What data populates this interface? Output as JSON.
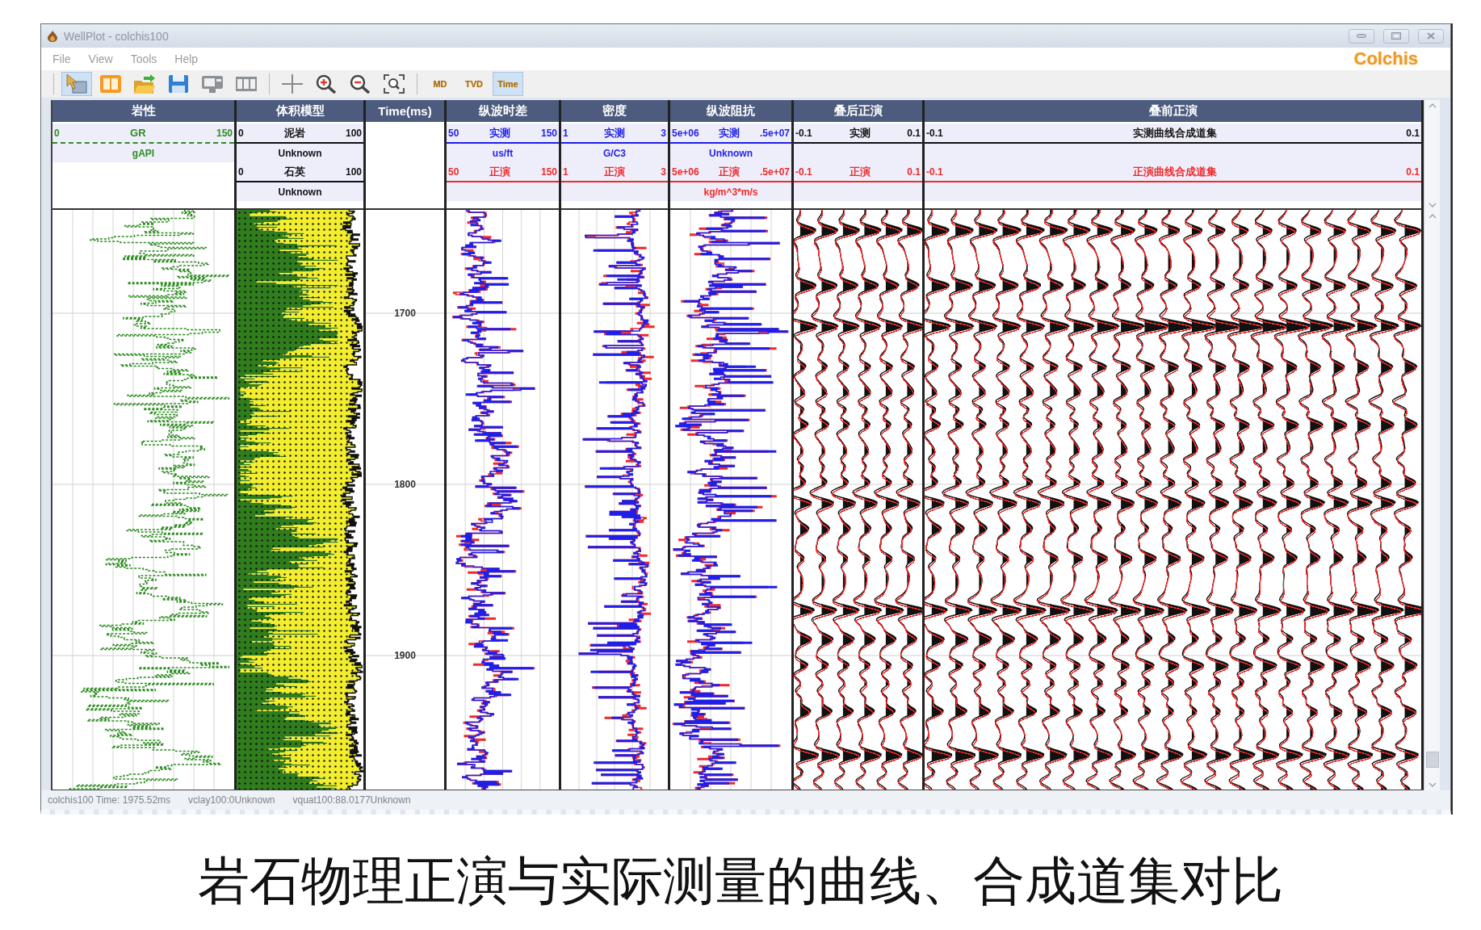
{
  "window": {
    "title": "WellPlot - colchis100",
    "logo": "Colchis"
  },
  "menu": [
    "File",
    "View",
    "Tools",
    "Help"
  ],
  "toolbar": {
    "tools": [
      {
        "selected": true
      },
      {
        "selected": false
      },
      {
        "selected": false
      },
      {
        "selected": false
      },
      {
        "selected": false
      },
      {
        "selected": false
      },
      {
        "selected": false
      },
      {
        "selected": false
      },
      {
        "selected": false
      },
      {
        "selected": false
      }
    ],
    "modes": [
      {
        "label": "MD",
        "selected": false
      },
      {
        "label": "TVD",
        "selected": false
      },
      {
        "label": "Time",
        "selected": true
      }
    ]
  },
  "tracks": [
    {
      "kind": "log",
      "title": "岩性",
      "curves": [
        {
          "min": "0",
          "name": "GR",
          "max": "150",
          "unit": "gAPI",
          "color": "#2e8b22",
          "dashed": true
        }
      ]
    },
    {
      "kind": "fill",
      "title": "体积模型",
      "curves": [
        {
          "min": "0",
          "name": "泥岩",
          "max": "100",
          "unit": "Unknown",
          "color": "#2f7d1c",
          "dashed": false
        },
        {
          "min": "0",
          "name": "石英",
          "max": "100",
          "unit": "Unknown",
          "color": "#f2ee2e",
          "dashed": false
        }
      ]
    },
    {
      "kind": "depth",
      "title": "Time(ms)",
      "ticks": [
        "1700",
        "1800",
        "1900"
      ]
    },
    {
      "kind": "log",
      "title": "纵波时差",
      "curves": [
        {
          "min": "50",
          "name": "实测",
          "max": "150",
          "unit": "us/ft",
          "color": "#1f1fe8",
          "dashed": false
        },
        {
          "min": "50",
          "name": "正演",
          "max": "150",
          "color": "#ee2a2a",
          "dashed": false
        }
      ]
    },
    {
      "kind": "log",
      "title": "密度",
      "curves": [
        {
          "min": "1",
          "name": "实测",
          "max": "3",
          "unit": "G/C3",
          "color": "#1f1fe8",
          "dashed": false
        },
        {
          "min": "1",
          "name": "正演",
          "max": "3",
          "color": "#ee2a2a",
          "dashed": false
        }
      ]
    },
    {
      "kind": "log",
      "title": "纵波阻抗",
      "curves": [
        {
          "min": "5e+06",
          "name": "实测",
          "max": ".5e+07",
          "unit": "Unknown",
          "color": "#1f1fe8",
          "dashed": false
        },
        {
          "min": "5e+06",
          "name": "正演",
          "max": ".5e+07",
          "unit": "kg/m^3*m/s",
          "color": "#ee2a2a",
          "dashed": false
        }
      ]
    },
    {
      "kind": "seismic",
      "title": "叠后正演",
      "curves": [
        {
          "min": "-0.1",
          "name": "实测",
          "max": "0.1",
          "color": "#111111",
          "dashed": false
        },
        {
          "min": "-0.1",
          "name": "正演",
          "max": "0.1",
          "color": "#ee2a2a",
          "dashed": false
        }
      ]
    },
    {
      "kind": "seismic",
      "title": "叠前正演",
      "curves": [
        {
          "min": "-0.1",
          "name": "实测曲线合成道集",
          "max": "0.1",
          "color": "#111111",
          "dashed": false
        },
        {
          "min": "-0.1",
          "name": "正演曲线合成道集",
          "max": "0.1",
          "color": "#ee2a2a",
          "dashed": false
        }
      ]
    }
  ],
  "status_bar": [
    "colchis100 Time: 1975.52ms",
    "vclay100:0Unknown",
    "vquat100:88.0177Unknown"
  ],
  "caption": "岩石物理正演与实际测量的曲线、合成道集对比"
}
